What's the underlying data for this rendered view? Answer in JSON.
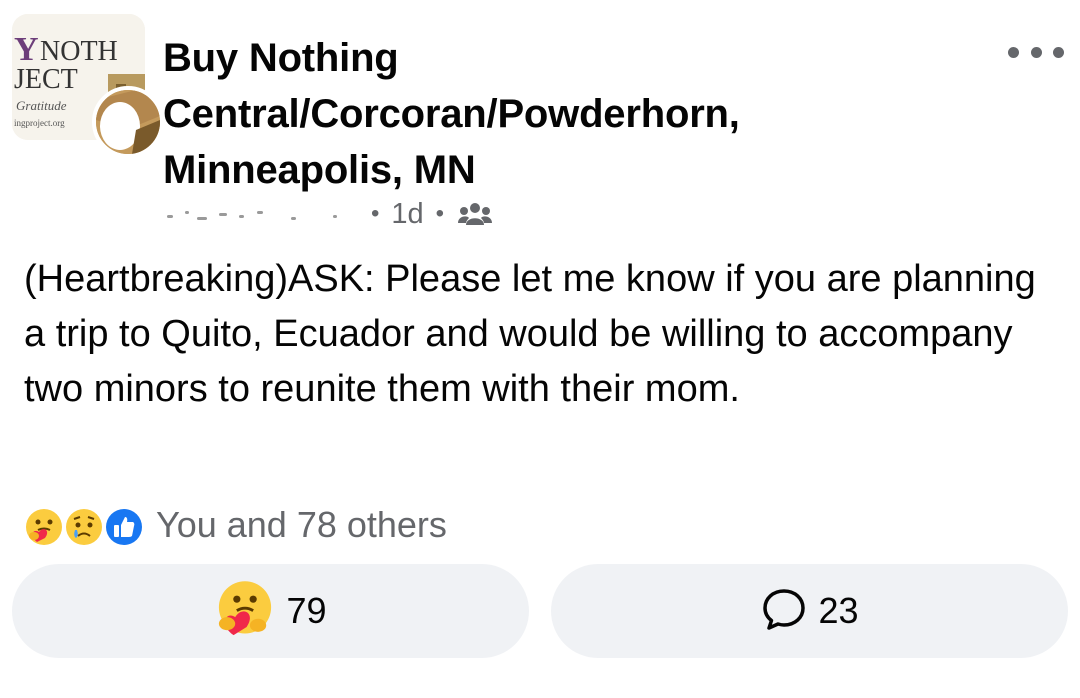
{
  "group": {
    "avatar_text": [
      "NOTH",
      "JECT",
      "Gratitude",
      "ingproject.org"
    ],
    "name": "Buy Nothing Central/Corcoran/Powderhorn, Minneapolis, MN"
  },
  "meta": {
    "separator": "•",
    "time": "1d",
    "audience_icon": "members-icon"
  },
  "post": {
    "text": "(Heartbreaking)ASK: Please let me know if you are planning a trip to Quito, Ecuador and would be willing to accompany two minors to reunite them with their mom."
  },
  "reactions": {
    "icons": [
      "care-reaction-icon",
      "sad-reaction-icon",
      "like-reaction-icon"
    ],
    "summary": "You and 78 others"
  },
  "actions": {
    "react_icon": "care-reaction-icon",
    "react_count": "79",
    "comment_icon": "comment-icon",
    "comment_count": "23"
  },
  "colors": {
    "text_primary": "#050505",
    "text_secondary": "#65676b",
    "button_bg": "#f0f2f5",
    "like_blue": "#1877f2",
    "reaction_yellow": "#fbcc3f",
    "heart_red": "#f0284a"
  }
}
